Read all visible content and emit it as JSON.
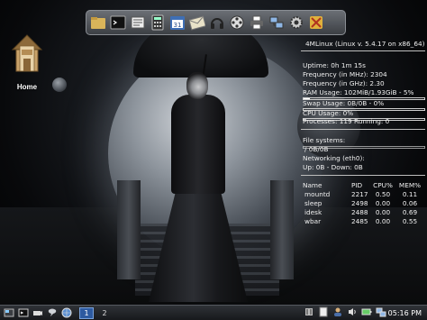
{
  "desktop": {
    "icons": [
      {
        "label": "Home",
        "icon": "home-folder-icon"
      }
    ]
  },
  "dock": {
    "items": [
      {
        "icon": "file-manager-icon"
      },
      {
        "icon": "terminal-icon"
      },
      {
        "icon": "text-editor-icon"
      },
      {
        "icon": "calculator-icon"
      },
      {
        "icon": "calendar-icon",
        "text": "31"
      },
      {
        "icon": "mail-icon"
      },
      {
        "icon": "headphones-icon"
      },
      {
        "icon": "film-reel-icon"
      },
      {
        "icon": "printer-icon"
      },
      {
        "icon": "network-icon"
      },
      {
        "icon": "settings-gear-icon"
      },
      {
        "icon": "tools-icon"
      }
    ]
  },
  "conky": {
    "header": "4MLinux (Linux v. 5.4.17 on x86_64)",
    "uptime": "Uptime: 0h 1m 15s",
    "freq_mhz": "Frequency (in MHz): 2304",
    "freq_ghz": "Frequency (in GHz): 2.30",
    "ram": "RAM Usage: 102MiB/1.93GiB - 5%",
    "ram_percent": 5,
    "swap": "Swap Usage: 0B/0B - 0%",
    "swap_percent": 0,
    "cpu": "CPU Usage: 0%",
    "cpu_percent": 0,
    "processes": "Processes: 119  Running: 0",
    "fs_title": "File systems:",
    "fs_root": "/ 0B/0B",
    "fs_percent": 0,
    "net_title": "Networking (eth0):",
    "net": "Up: 0B  - Down: 0B",
    "proc_headers": [
      "Name",
      "PID",
      "CPU%",
      "MEM%"
    ],
    "procs": [
      [
        "mountd",
        "2217",
        "0.50",
        "0.11"
      ],
      [
        "sleep",
        "2498",
        "0.00",
        "0.06"
      ],
      [
        "idesk",
        "2488",
        "0.00",
        "0.69"
      ],
      [
        "wbar",
        "2485",
        "0.00",
        "0.55"
      ]
    ]
  },
  "taskbar": {
    "start_icons": [
      "launcher-icon",
      "terminal-icon",
      "camera-icon",
      "messenger-icon",
      "globe-icon"
    ],
    "workspaces": [
      {
        "label": "1",
        "active": true
      },
      {
        "label": "2",
        "active": false
      }
    ],
    "tray_icons": [
      "mixer-icon",
      "document-icon",
      "user-icon",
      "volume-icon",
      "battery-icon",
      "network-icon"
    ],
    "clock": "05:16 PM"
  }
}
